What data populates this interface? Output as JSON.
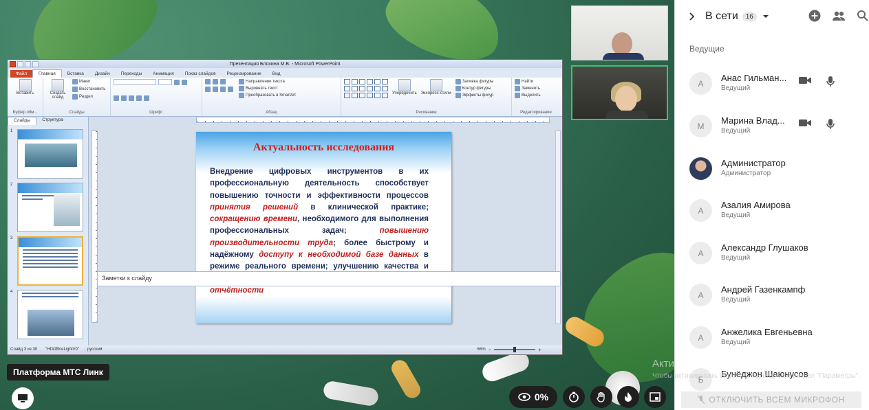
{
  "ppt": {
    "window_title": "Презентация Блохина М.В. - Microsoft PowerPoint",
    "tabs": [
      "Файл",
      "Главная",
      "Вставка",
      "Дизайн",
      "Переходы",
      "Анимация",
      "Показ слайдов",
      "Рецензирование",
      "Вид"
    ],
    "ribbon": {
      "paste": "Вставить",
      "create_slide": "Создать слайд",
      "layout": "Макет",
      "reset": "Восстановить",
      "section": "Раздел",
      "text_direction": "Направление текста",
      "align_text": "Выровнять текст",
      "convert_smartart": "Преобразовать в SmartArt",
      "arrange": "Упорядочить",
      "quick_styles": "Экспресс-стили",
      "shape_fill": "Заливка фигуры",
      "shape_outline": "Контур фигуры",
      "shape_effects": "Эффекты фигур",
      "find": "Найти",
      "replace": "Заменить",
      "select": "Выделить",
      "group_clipboard": "Буфер обм...",
      "group_slides": "Слайды",
      "group_font": "Шрифт",
      "group_paragraph": "Абзац",
      "group_drawing": "Рисование",
      "group_editing": "Редактирование"
    },
    "panel_tabs": [
      "Слайды",
      "Структура"
    ],
    "thumbnails": [
      "1",
      "2",
      "3",
      "4"
    ],
    "slide": {
      "title": "Актуальность исследования",
      "t1": "Внедрение цифровых инструментов в их профессиональную деятельность способствует повышению точности и эффективности процессов ",
      "h1": "принятия решений",
      "t2": " в клинической практике; ",
      "h2": "сокращению времени",
      "t3": ", необходимого для выполнения профессиональных задач; ",
      "h3": "повышению производительности труда",
      "t4": "; более быстрому и надёжному ",
      "h4": "доступу к необходимой базе данных",
      "t5": " в режиме реального времени; улучшению качества и своевременности ",
      "h5": "формирования различной отчётности"
    },
    "notes_placeholder": "Заметки к слайду",
    "status": {
      "slide_counter": "Слайд 3 из 30",
      "theme": "\"HDOfficeLightV0\"",
      "language": "русский",
      "zoom": "66%"
    }
  },
  "conference": {
    "platform_label": "Платформа МТС Линк",
    "views_percent": "0%",
    "activation_title": "Активация Windows",
    "activation_sub": "Чтобы активировать Windows, перейдите в раздел \"Параметры\"."
  },
  "panel": {
    "title": "В сети",
    "count": "16",
    "section": "Ведущие",
    "participants": [
      {
        "initial": "А",
        "name": "Анас Гильман...",
        "role": "Ведущий"
      },
      {
        "initial": "М",
        "name": "Марина Влад...",
        "role": "Ведущий"
      },
      {
        "initial": "",
        "name": "Администратор",
        "role": "Администратор"
      },
      {
        "initial": "А",
        "name": "Азалия Амирова",
        "role": "Ведущий"
      },
      {
        "initial": "А",
        "name": "Александр Глушаков",
        "role": "Ведущий"
      },
      {
        "initial": "А",
        "name": "Андрей Газенкампф",
        "role": "Ведущий"
      },
      {
        "initial": "А",
        "name": "Анжелика Евгеньевна",
        "role": "Ведущий"
      },
      {
        "initial": "Б",
        "name": "Бунёджон Шаюнусов",
        "role": ""
      }
    ],
    "mute_all": "ОТКЛЮЧИТЬ ВСЕМ МИКРОФОН"
  },
  "colors": {
    "accent_red": "#c0201f",
    "slide_text": "#1f2f5a",
    "active_speaker": "#43c06f"
  }
}
